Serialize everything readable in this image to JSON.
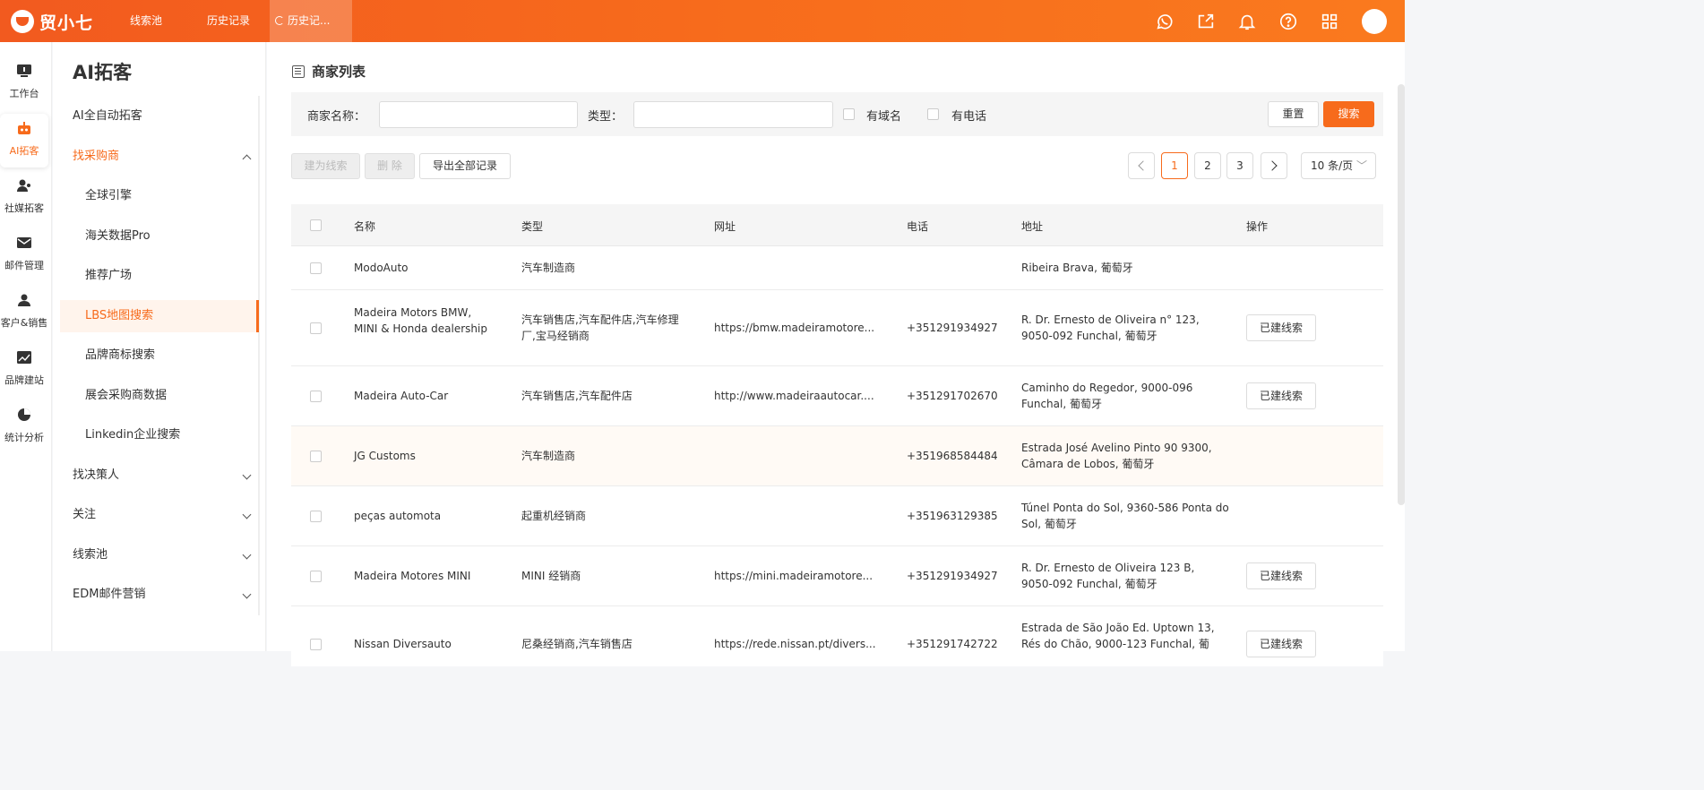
{
  "app": {
    "brand": "贸小七"
  },
  "topnav": {
    "tab1": "线索池",
    "tab2": "历史记录",
    "tab3": "历史记..."
  },
  "rail": [
    {
      "label": "工作台",
      "icon": "monitor-icon"
    },
    {
      "label": "AI拓客",
      "icon": "robot-icon"
    },
    {
      "label": "社媒拓客",
      "icon": "social-users-icon"
    },
    {
      "label": "邮件管理",
      "icon": "mail-icon"
    },
    {
      "label": "客户&销售",
      "icon": "customer-icon"
    },
    {
      "label": "品牌建站",
      "icon": "chart-line-icon"
    },
    {
      "label": "统计分析",
      "icon": "pie-chart-icon"
    }
  ],
  "submenu": {
    "title": "AI拓客",
    "items": [
      "AI全自动拓客",
      "找采购商",
      "全球引擎",
      "海关数据Pro",
      "推荐广场",
      "LBS地图搜索",
      "品牌商标搜索",
      "展会采购商数据",
      "Linkedin企业搜索",
      "找决策人",
      "关注",
      "线索池",
      "EDM邮件营销"
    ]
  },
  "page": {
    "title": "商家列表"
  },
  "filter": {
    "name_label": "商家名称：",
    "type_label": "类型：",
    "domain_label": "有域名",
    "phone_label": "有电话",
    "reset": "重置",
    "search": "搜索"
  },
  "actions": {
    "to_lead": "建为线索",
    "delete": "删 除",
    "export": "导出全部记录"
  },
  "pagination": {
    "pages": [
      "1",
      "2",
      "3"
    ],
    "current": "1",
    "page_size": "10 条/页"
  },
  "table": {
    "headers": [
      "名称",
      "类型",
      "网址",
      "电话",
      "地址",
      "操作"
    ],
    "rows": [
      {
        "name": "ModoAuto",
        "type": "汽车制造商",
        "url": "",
        "phone": "",
        "address": "Ribeira Brava, 葡萄牙",
        "action": ""
      },
      {
        "name": "Madeira Motors BMW, MINI & Honda dealership",
        "type": "汽车销售店,汽车配件店,汽车修理厂,宝马经销商",
        "url": "https://bmw.madeiramotore...",
        "phone": "+351291934927",
        "address": "R. Dr. Ernesto de Oliveira n° 123, 9050-092 Funchal, 葡萄牙",
        "action": "已建线索"
      },
      {
        "name": "Madeira Auto-Car",
        "type": "汽车销售店,汽车配件店",
        "url": "http://www.madeiraautocar....",
        "phone": "+351291702670",
        "address": "Caminho do Regedor, 9000-096 Funchal, 葡萄牙",
        "action": "已建线索"
      },
      {
        "name": "JG Customs",
        "type": "汽车制造商",
        "url": "",
        "phone": "+351968584484",
        "address": "Estrada José Avelino Pinto 90 9300, Câmara de Lobos, 葡萄牙",
        "action": ""
      },
      {
        "name": "peças automota",
        "type": "起重机经销商",
        "url": "",
        "phone": "+351963129385",
        "address": "Túnel Ponta do Sol, 9360-586 Ponta do Sol, 葡萄牙",
        "action": ""
      },
      {
        "name": "Madeira Motores MINI",
        "type": "MINI 经销商",
        "url": "https://mini.madeiramotore...",
        "phone": "+351291934927",
        "address": "R. Dr. Ernesto de Oliveira 123 B, 9050-092 Funchal, 葡萄牙",
        "action": "已建线索"
      },
      {
        "name": "Nissan Diversauto",
        "type": "尼桑经销商,汽车销售店",
        "url": "https://rede.nissan.pt/divers...",
        "phone": "+351291742722",
        "address": "Estrada de São João Ed. Uptown 13, Rés do Chão, 9000-123 Funchal, 葡",
        "action": "已建线索"
      }
    ]
  }
}
